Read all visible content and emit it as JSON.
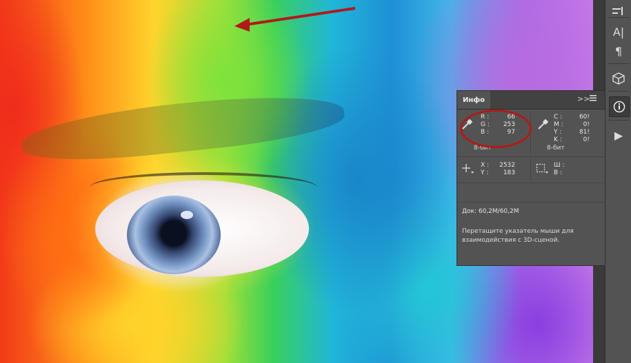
{
  "panel": {
    "tab": "Инфо",
    "collapse_icon": "double-chevron-right-icon",
    "menu_icon": "hamburger-menu-icon",
    "rgb": {
      "labels": [
        "R :",
        "G :",
        "B :"
      ],
      "values": [
        "66",
        "253",
        "97"
      ],
      "bit_depth": "8-бит"
    },
    "cmyk": {
      "labels": [
        "C :",
        "M :",
        "Y :",
        "K :"
      ],
      "values": [
        "60!",
        "0!",
        "81!",
        "0!"
      ],
      "bit_depth": "8-бит"
    },
    "position": {
      "labels": [
        "X :",
        "Y :"
      ],
      "values": [
        "2532",
        "183"
      ]
    },
    "size": {
      "labels": [
        "Ш :",
        "В :"
      ],
      "values": [
        "",
        ""
      ]
    },
    "doc_info": "Док: 60,2M/60,2M",
    "hint": "Перетащите указатель мыши для взаимодействия с 3D-сценой."
  },
  "toolstrip": {
    "icons": [
      "adjust-panel-icon",
      "character-icon",
      "paragraph-icon",
      "3d-cube-icon",
      "info-icon",
      "play-actions-icon"
    ],
    "character_glyph": "A|",
    "paragraph_glyph": "¶",
    "info_glyph": "ⓘ",
    "play_glyph": "▶"
  },
  "colors": {
    "annotation": "#b01a1a",
    "panel_bg": "#535353"
  }
}
